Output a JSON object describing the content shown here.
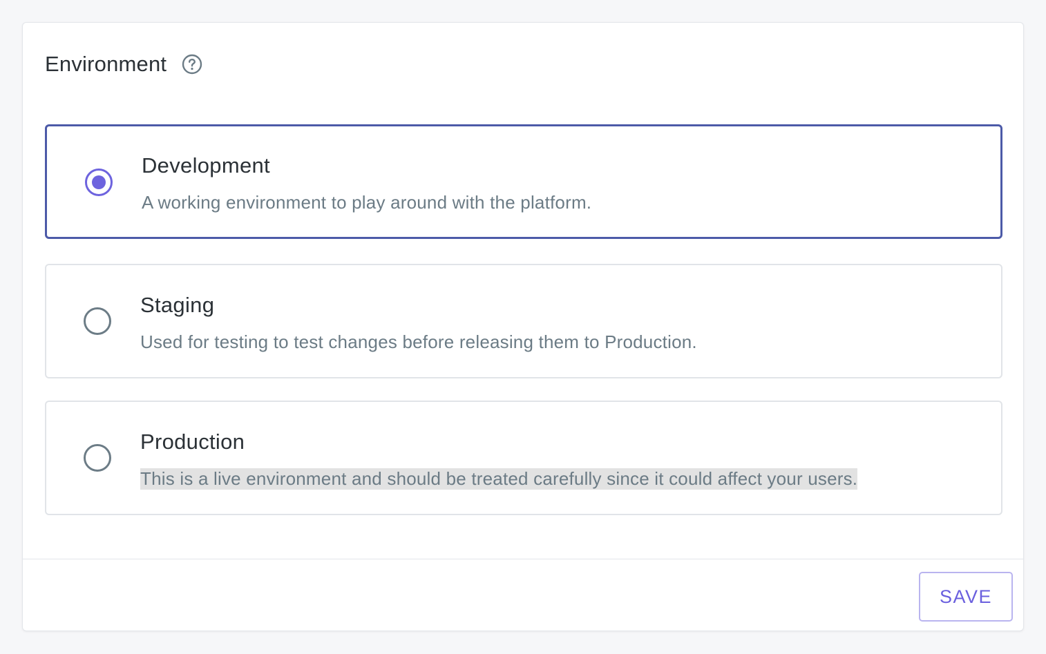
{
  "section": {
    "title": "Environment",
    "help_icon": "question-circle-icon"
  },
  "options": [
    {
      "title": "Development",
      "description": "A working environment to play around with the platform.",
      "selected": true
    },
    {
      "title": "Staging",
      "description": "Used for testing to test changes before releasing them to Production.",
      "selected": false
    },
    {
      "title": "Production",
      "description": "This is a live environment and should be treated carefully since it could affect your users.",
      "selected": false
    }
  ],
  "footer": {
    "save_label": "SAVE"
  },
  "colors": {
    "accent": "#6d63de",
    "selected_border": "#4c5aa8",
    "text_primary": "#2b3136",
    "text_secondary": "#6b7b85"
  }
}
